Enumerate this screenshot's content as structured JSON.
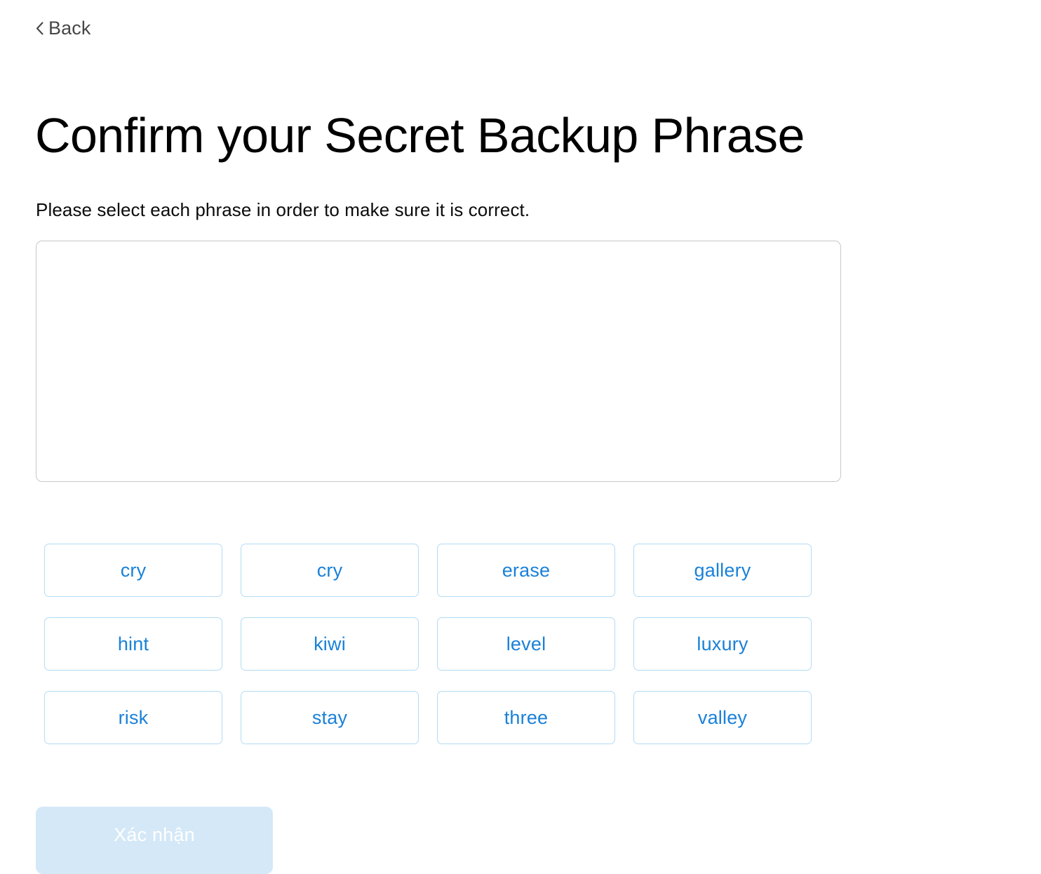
{
  "nav": {
    "back_label": "Back",
    "back_icon": "chevron-left-icon"
  },
  "header": {
    "title": "Confirm your Secret Backup Phrase",
    "subtitle": "Please select each phrase in order to make sure it is correct."
  },
  "phrase_input": {
    "value": "",
    "placeholder": ""
  },
  "word_bank": {
    "words": [
      "cry",
      "cry",
      "erase",
      "gallery",
      "hint",
      "kiwi",
      "level",
      "luxury",
      "risk",
      "stay",
      "three",
      "valley"
    ]
  },
  "footer": {
    "confirm_label": "Xác nhận"
  },
  "colors": {
    "accent_blue": "#1a81d8",
    "chip_border": "#b3dcf4",
    "box_border": "#c8c8c8",
    "confirm_disabled_bg": "#d4e8f7",
    "confirm_disabled_text": "#ffffff",
    "back_text": "#474747",
    "title_text": "#000000",
    "page_background": "#ffffff"
  }
}
